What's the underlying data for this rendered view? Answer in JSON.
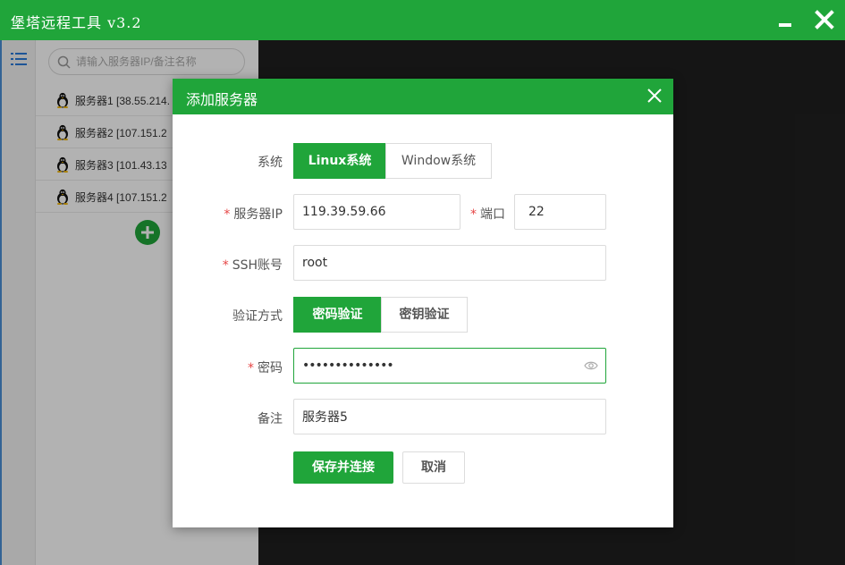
{
  "window": {
    "title": "堡塔远程工具 v3.2",
    "icons": {
      "minimize": "minimize-icon",
      "close": "close-icon"
    }
  },
  "sidebar": {
    "menu_icon": "list-icon",
    "search": {
      "placeholder": "请输入服务器IP/备注名称",
      "value": ""
    },
    "servers": [
      {
        "label": "服务器1 [38.55.214.",
        "icon": "linux-tux-icon"
      },
      {
        "label": "服务器2 [107.151.2",
        "icon": "linux-tux-icon"
      },
      {
        "label": "服务器3 [101.43.13",
        "icon": "linux-tux-icon"
      },
      {
        "label": "服务器4 [107.151.2",
        "icon": "linux-tux-icon"
      }
    ],
    "add_icon": "plus-circle-icon"
  },
  "dialog": {
    "title": "添加服务器",
    "system": {
      "label": "系统",
      "options": [
        "Linux系统",
        "Window系统"
      ],
      "selected": "Linux系统"
    },
    "server_ip": {
      "required_mark": "*",
      "label": "服务器IP",
      "value": "119.39.59.66"
    },
    "port": {
      "required_mark": "*",
      "label": "端口",
      "value": "22"
    },
    "ssh_account": {
      "required_mark": "*",
      "label": "SSH账号",
      "value": "root"
    },
    "auth": {
      "label": "验证方式",
      "options": [
        "密码验证",
        "密钥验证"
      ],
      "selected": "密码验证"
    },
    "password": {
      "required_mark": "*",
      "label": "密码",
      "value": "••••••••••••••",
      "toggle_icon": "eye-icon"
    },
    "remark": {
      "label": "备注",
      "value": "服务器5"
    },
    "buttons": {
      "save": "保存并连接",
      "cancel": "取消"
    }
  },
  "colors": {
    "brand_green": "#20a53a",
    "required_red": "#e64545",
    "terminal_bg": "#1f1f1f"
  }
}
